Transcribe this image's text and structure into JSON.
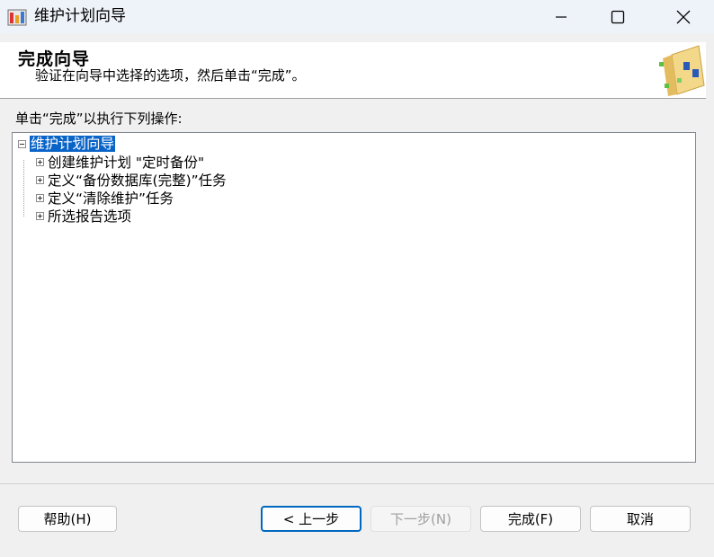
{
  "window": {
    "title": "维护计划向导"
  },
  "header": {
    "title": "完成向导",
    "subtitle": "验证在向导中选择的选项，然后单击“完成”。"
  },
  "instruction": "单击“完成”以执行下列操作:",
  "tree": {
    "root": "维护计划向导",
    "items": [
      "创建维护计划 \"定时备份\"",
      "定义“备份数据库(完整)”任务",
      "定义“清除维护”任务",
      "所选报告选项"
    ]
  },
  "buttons": {
    "help": "帮助(H)",
    "back": "< 上一步",
    "next": "下一步(N)",
    "finish": "完成(F)",
    "cancel": "取消"
  },
  "colors": {
    "selection": "#0a64c8",
    "focus_border": "#0067c0"
  }
}
